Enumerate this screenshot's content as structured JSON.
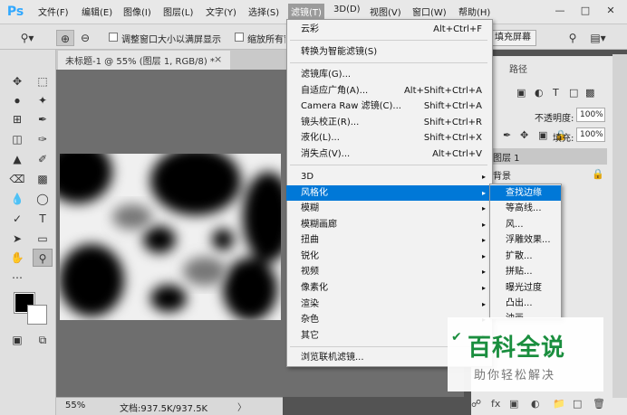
{
  "app": {
    "logo": "Ps"
  },
  "menubar": [
    "文件(F)",
    "编辑(E)",
    "图像(I)",
    "图层(L)",
    "文字(Y)",
    "选择(S)",
    "滤镜(T)",
    "3D(D)",
    "视图(V)",
    "窗口(W)",
    "帮助(H)"
  ],
  "window_controls": [
    "—",
    "□",
    "✕"
  ],
  "options": {
    "resize_label": "调整窗口大小以满屏显示",
    "zoom_all_label": "缩放所有窗口",
    "fill_screen": "填充屏幕"
  },
  "document": {
    "tab_title": "未标题-1 @ 55% (图层 1, RGB/8) *",
    "close": "×"
  },
  "status": {
    "zoom": "55%",
    "doc_size": "文档:937.5K/937.5K",
    "arrow": "〉"
  },
  "panel": {
    "tab_paths": "路径",
    "opacity_label": "不透明度:",
    "opacity_value": "100%",
    "fill_label": "填充:",
    "fill_value": "100%",
    "layers": [
      "图层 1",
      "背景"
    ]
  },
  "filter_menu": {
    "items": [
      {
        "label": "云彩",
        "shortcut": "Alt+Ctrl+F"
      },
      {
        "label": "转换为智能滤镜(S)",
        "shortcut": ""
      },
      {
        "label": "滤镜库(G)...",
        "shortcut": ""
      },
      {
        "label": "自适应广角(A)...",
        "shortcut": "Alt+Shift+Ctrl+A"
      },
      {
        "label": "Camera Raw 滤镜(C)...",
        "shortcut": "Shift+Ctrl+A"
      },
      {
        "label": "镜头校正(R)...",
        "shortcut": "Shift+Ctrl+R"
      },
      {
        "label": "液化(L)...",
        "shortcut": "Shift+Ctrl+X"
      },
      {
        "label": "消失点(V)...",
        "shortcut": "Alt+Ctrl+V"
      },
      {
        "label": "3D",
        "shortcut": ""
      },
      {
        "label": "风格化",
        "shortcut": ""
      },
      {
        "label": "模糊",
        "shortcut": ""
      },
      {
        "label": "模糊画廊",
        "shortcut": ""
      },
      {
        "label": "扭曲",
        "shortcut": ""
      },
      {
        "label": "锐化",
        "shortcut": ""
      },
      {
        "label": "视频",
        "shortcut": ""
      },
      {
        "label": "像素化",
        "shortcut": ""
      },
      {
        "label": "渲染",
        "shortcut": ""
      },
      {
        "label": "杂色",
        "shortcut": ""
      },
      {
        "label": "其它",
        "shortcut": ""
      },
      {
        "label": "浏览联机滤镜...",
        "shortcut": ""
      }
    ],
    "arrow": "▸"
  },
  "stylize_submenu": [
    "查找边缘",
    "等高线...",
    "风...",
    "浮雕效果...",
    "扩散...",
    "拼贴...",
    "曝光过度",
    "凸出...",
    "油画..."
  ],
  "watermark": {
    "title": "百科全说",
    "subtitle": "助你轻松解决"
  },
  "colors": {
    "accent": "#0078d7",
    "watermark_green": "#1a8e3e"
  }
}
